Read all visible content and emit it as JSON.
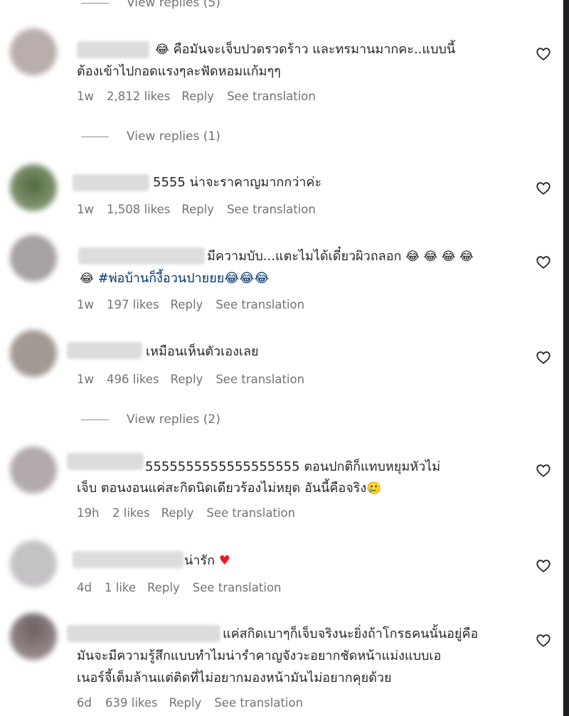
{
  "comments": [
    {
      "avatar_color": "#b9aeab",
      "line1_emoji": "😂",
      "line1": " คือมันจะเจ็บปวดรวดร้าว และทรมานมากคะ..แบบนี้",
      "line2": "ต้องเข้าไปกอดแรงๆละฟัดหอมแก้มๆๆ",
      "time": "1w",
      "likes": "2,812 likes",
      "reply": "Reply",
      "see_translation": "See translation"
    },
    {
      "avatar_color": "#6f8a5e",
      "line1": "5555 น่าจะราคาญมากกว่าค่ะ",
      "time": "1w",
      "likes": "1,508 likes",
      "reply": "Reply",
      "see_translation": "See translation"
    },
    {
      "avatar_color": "#a8a1a1",
      "line1": "มีความบับ...แตะไมได้เดี๋ยวผิวถลอก ",
      "line1_emoji": "😂 😂 😂 😂",
      "line2_emoji": "😂",
      "line2_tag": "#พ่อบ้านก็งี้อวนปายยย😂😂😂",
      "time": "1w",
      "likes": "197 likes",
      "reply": "Reply",
      "see_translation": "See translation"
    },
    {
      "avatar_color": "#a39a93",
      "line1": "เหมือนเห็นตัวเองเลย",
      "time": "1w",
      "likes": "496 likes",
      "reply": "Reply",
      "see_translation": "See translation"
    },
    {
      "avatar_color": "#b3aab0",
      "line1": "5555555555555555555 ตอนปกติก็แทบหยุมหัวไม่",
      "line2": "เจ็บ ตอนงอนแค่สะกิดนิดเดียวร้องไม่หยุด อันนี้คือจริง",
      "line2_emoji": "🥲",
      "time": "19h",
      "likes": "2 likes",
      "reply": "Reply",
      "see_translation": "See translation"
    },
    {
      "avatar_color": "#c4c2c4",
      "line1": "น่ารัก ",
      "line1_emoji": "♥",
      "time": "4d",
      "likes": "1 like",
      "reply": "Reply",
      "see_translation": "See translation"
    },
    {
      "avatar_color": "#8b7f80",
      "line1": "แค่สกิดเบาๆก็เจ็บจริงนะยิ่งถ้าโกรธคนนั้นอยู่คือ",
      "line2": "มันจะมีความรู้สึกแบบทำไมน่ารำคาญจังวะอยากชัดหน้าแม่งแบบเอ",
      "line3": "เนอร์จี้เต็มล้านแต่ติดที่ไม่อยากมองหน้ามันไม่อยากคุยด้วย",
      "time": "6d",
      "likes": "639 likes",
      "reply": "Reply",
      "see_translation": "See translation"
    }
  ],
  "view_replies": {
    "top": "View replies (5)",
    "after_comment_1": "View replies (1)",
    "after_comment_4": "View replies (2)"
  }
}
